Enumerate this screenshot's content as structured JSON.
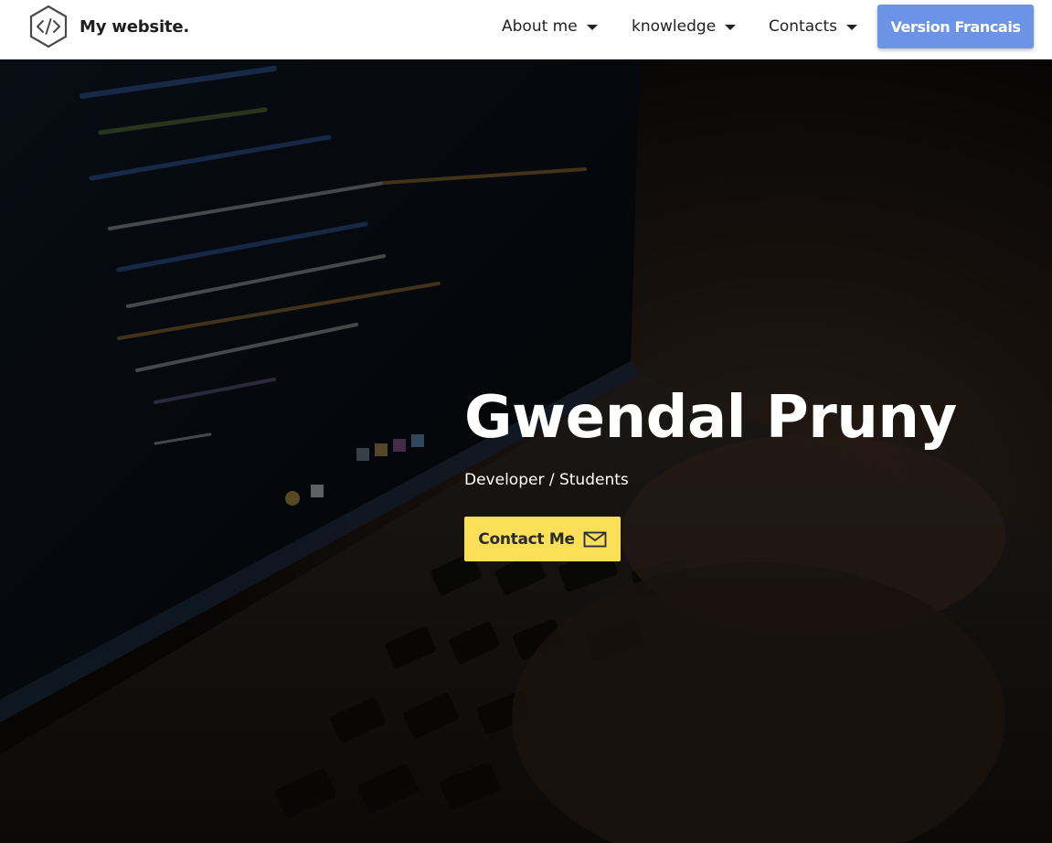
{
  "brand": {
    "logo_icon": "code-hexagon-icon",
    "name": "My website."
  },
  "nav": {
    "items": [
      {
        "label": "About me",
        "icon": "caret-down-icon"
      },
      {
        "label": "knowledge",
        "icon": "caret-down-icon"
      },
      {
        "label": "Contacts",
        "icon": "caret-down-icon"
      }
    ],
    "language_button": "Version Francais"
  },
  "hero": {
    "background": "laptop-code-keyboard-photo",
    "title": "Gwendal Pruny",
    "subtitle": "Developer / Students",
    "cta_label": "Contact Me",
    "cta_icon": "mail-icon"
  },
  "colors": {
    "header_bg": "#ffffff",
    "language_button_bg": "#6c93e5",
    "cta_bg": "#fbdf56",
    "hero_text": "#ffffff"
  }
}
